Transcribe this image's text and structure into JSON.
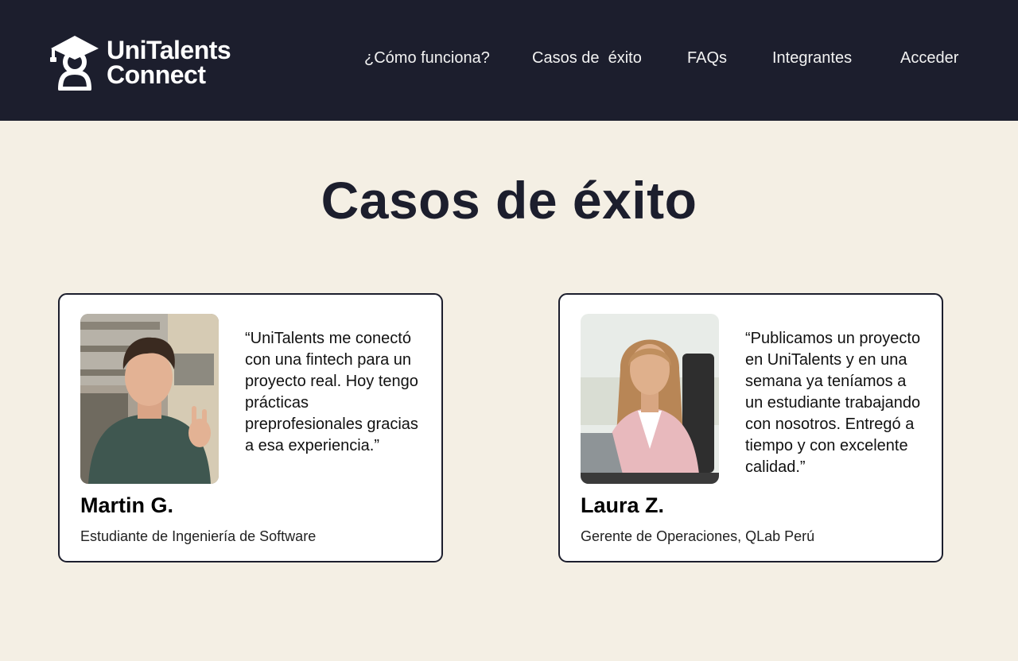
{
  "header": {
    "logo": {
      "line1": "UniTalents",
      "line2": "Connect",
      "icon": "graduate-cap-person-icon"
    },
    "nav": [
      {
        "id": "como-funciona",
        "label": "¿Cómo funciona?"
      },
      {
        "id": "casos-exito",
        "label": "Casos de  éxito"
      },
      {
        "id": "faqs",
        "label": "FAQs"
      },
      {
        "id": "integrantes",
        "label": "Integrantes"
      },
      {
        "id": "acceder",
        "label": "Acceder"
      }
    ]
  },
  "main": {
    "title": "Casos de éxito",
    "testimonials": [
      {
        "quote": "“UniTalents me conectó con una fintech para un proyecto real. Hoy tengo prácticas preprofesionales gracias a esa experiencia.”",
        "name": "Martin G.",
        "role": "Estudiante de Ingeniería de Software"
      },
      {
        "quote": "“Publicamos un proyecto en UniTalents y en una semana ya teníamos a un estudiante trabajando con nosotros. Entregó a tiempo y con excelente calidad.”",
        "name": "Laura Z.",
        "role": "Gerente de Operaciones, QLab Perú"
      }
    ]
  },
  "colors": {
    "nav_bg": "#1c1e2d",
    "page_bg": "#f4efe4",
    "card_bg": "#ffffff",
    "title": "#1c1e2d"
  }
}
